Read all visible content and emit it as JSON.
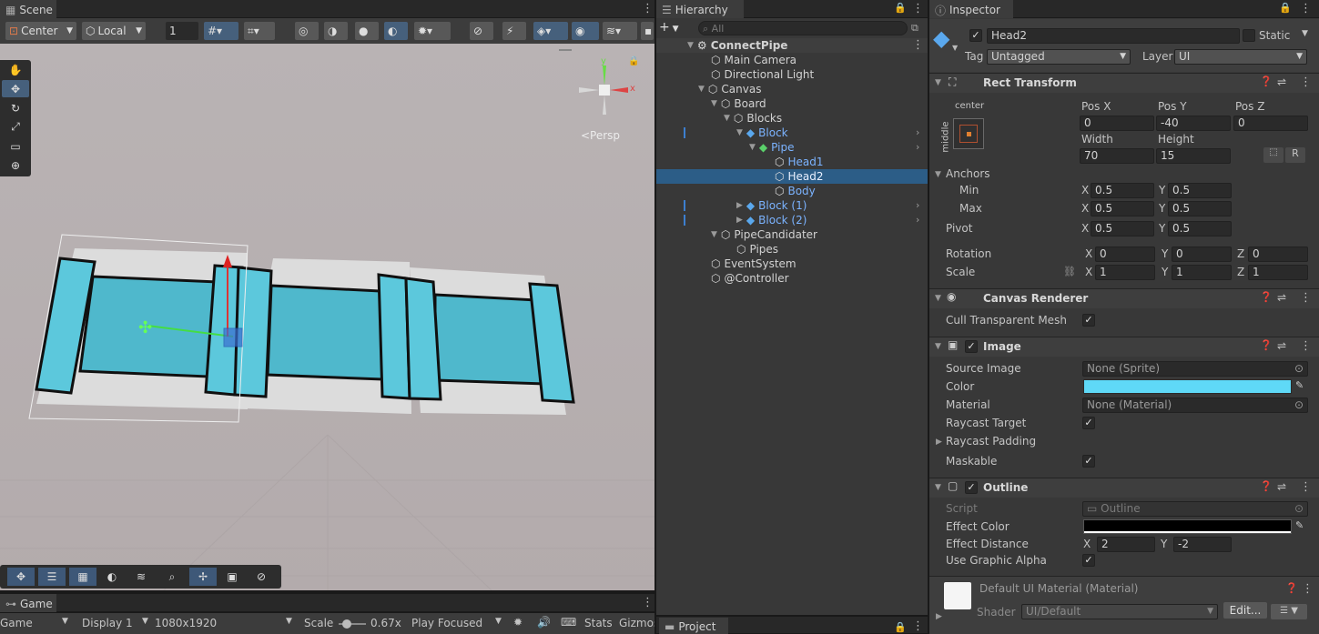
{
  "scene": {
    "tab": "Scene",
    "pivot_mode": "Center",
    "space": "Local",
    "grid_value": "1",
    "persp_label": "<Persp",
    "gizmo_axes": {
      "x": "x",
      "y": "y"
    }
  },
  "game": {
    "tab": "Game",
    "mode": "Game",
    "display": "Display 1",
    "resolution": "1080x1920",
    "scale_label": "Scale",
    "scale_value": "0.67x",
    "play_mode": "Play Focused",
    "stats": "Stats",
    "gizmos": "Gizmos"
  },
  "hierarchy": {
    "tab": "Hierarchy",
    "search_placeholder": "All",
    "root": "ConnectPipe",
    "items": [
      {
        "label": "Main Camera"
      },
      {
        "label": "Directional Light"
      },
      {
        "label": "Canvas"
      },
      {
        "label": "Board"
      },
      {
        "label": "Blocks"
      },
      {
        "label": "Block"
      },
      {
        "label": "Pipe"
      },
      {
        "label": "Head1"
      },
      {
        "label": "Head2"
      },
      {
        "label": "Body"
      },
      {
        "label": "Block (1)"
      },
      {
        "label": "Block (2)"
      },
      {
        "label": "PipeCandidater"
      },
      {
        "label": "Pipes"
      },
      {
        "label": "EventSystem"
      },
      {
        "label": "@Controller"
      }
    ]
  },
  "project": {
    "tab": "Project"
  },
  "inspector": {
    "tab": "Inspector",
    "object_name": "Head2",
    "static_label": "Static",
    "tag_label": "Tag",
    "tag_value": "Untagged",
    "layer_label": "Layer",
    "layer_value": "UI",
    "rect_transform": {
      "title": "Rect Transform",
      "anchor_h": "center",
      "anchor_v": "middle",
      "pos_x_label": "Pos X",
      "pos_y_label": "Pos Y",
      "pos_z_label": "Pos Z",
      "pos_x": "0",
      "pos_y": "-40",
      "pos_z": "0",
      "width_label": "Width",
      "height_label": "Height",
      "width": "70",
      "height": "15",
      "r_button": "R",
      "anchors_label": "Anchors",
      "min_label": "Min",
      "max_label": "Max",
      "min_x": "0.5",
      "min_y": "0.5",
      "max_x": "0.5",
      "max_y": "0.5",
      "pivot_label": "Pivot",
      "pivot_x": "0.5",
      "pivot_y": "0.5",
      "rotation_label": "Rotation",
      "rot_x": "0",
      "rot_y": "0",
      "rot_z": "0",
      "scale_label": "Scale",
      "scale_x": "1",
      "scale_y": "1",
      "scale_z": "1",
      "x": "X",
      "y": "Y",
      "z": "Z"
    },
    "canvas_renderer": {
      "title": "Canvas Renderer",
      "cull_label": "Cull Transparent Mesh"
    },
    "image": {
      "title": "Image",
      "source_label": "Source Image",
      "source_value": "None (Sprite)",
      "color_label": "Color",
      "color": "#5fd9f7",
      "material_label": "Material",
      "material_value": "None (Material)",
      "raycast_target_label": "Raycast Target",
      "raycast_padding_label": "Raycast Padding",
      "maskable_label": "Maskable"
    },
    "outline": {
      "title": "Outline",
      "script_label": "Script",
      "script_value": "Outline",
      "effect_color_label": "Effect Color",
      "effect_color": "#000000",
      "effect_distance_label": "Effect Distance",
      "dist_x": "2",
      "dist_y": "-2",
      "use_alpha_label": "Use Graphic Alpha"
    },
    "material": {
      "title": "Default UI Material (Material)",
      "shader_label": "Shader",
      "shader_value": "UI/Default",
      "edit_button": "Edit..."
    }
  },
  "colors": {
    "selection": "#2c5d87",
    "pipe_fill": "#4fb8cc",
    "scene_bg": "#b5aeb0"
  }
}
